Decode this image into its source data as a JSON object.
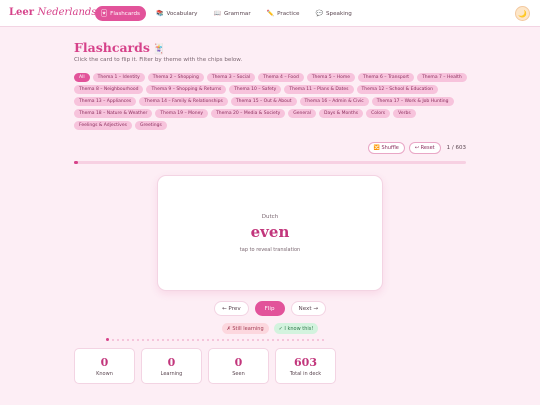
{
  "brand": {
    "name": "Leer",
    "name_italic": "Nederlands",
    "logo_icon": "tulip-icon"
  },
  "nav": [
    {
      "icon": "🃏",
      "label": "Flashcards",
      "active": true
    },
    {
      "icon": "📚",
      "label": "Vocabulary"
    },
    {
      "icon": "📖",
      "label": "Grammar"
    },
    {
      "icon": "✏️",
      "label": "Practice"
    },
    {
      "icon": "💬",
      "label": "Speaking"
    }
  ],
  "theme_toggle": {
    "icon": "🌙"
  },
  "page": {
    "title": "Flashcards",
    "title_icon": "🃏",
    "subtitle": "Click the card to flip it. Filter by theme with the chips below."
  },
  "chips": [
    "All",
    "Thema 1 – Identity",
    "Thema 2 – Shopping",
    "Thema 3 – Social",
    "Thema 4 – Food",
    "Thema 5 – Home",
    "Thema 6 – Transport",
    "Thema 7 – Health",
    "Thema 8 – Neighbourhood",
    "Thema 9 – Shopping & Returns",
    "Thema 10 – Safety",
    "Thema 11 – Plans & Dates",
    "Thema 12 – School & Education",
    "Thema 13 – Appliances",
    "Thema 14 – Family & Relationships",
    "Thema 15 – Out & About",
    "Thema 16 – Admin & Civic",
    "Thema 17 – Work & Job Hunting",
    "Thema 18 – Nature & Weather",
    "Thema 19 – Money",
    "Thema 20 – Media & Society",
    "General",
    "Days & Months",
    "Colors",
    "Verbs",
    "Feelings & Adjectives",
    "Greetings"
  ],
  "controls": {
    "shuffle": "🔀 Shuffle",
    "reset": "↩ Reset",
    "count": "1 / 603",
    "progress": 0.0017
  },
  "card": {
    "language": "Dutch",
    "word": "even",
    "hint": "tap to reveal translation"
  },
  "buttons": {
    "prev": "← Prev",
    "flip": "Flip",
    "next": "Next →"
  },
  "marks": {
    "still": "✗ Still learning",
    "know": "✓ I know this!"
  },
  "stats": [
    {
      "value": "0",
      "label": "Known"
    },
    {
      "value": "0",
      "label": "Learning"
    },
    {
      "value": "0",
      "label": "Seen"
    },
    {
      "value": "603",
      "label": "Total in deck"
    }
  ],
  "colors": {
    "accent": "#e2539a",
    "title": "#d6428a",
    "background": "#fdeef5"
  }
}
